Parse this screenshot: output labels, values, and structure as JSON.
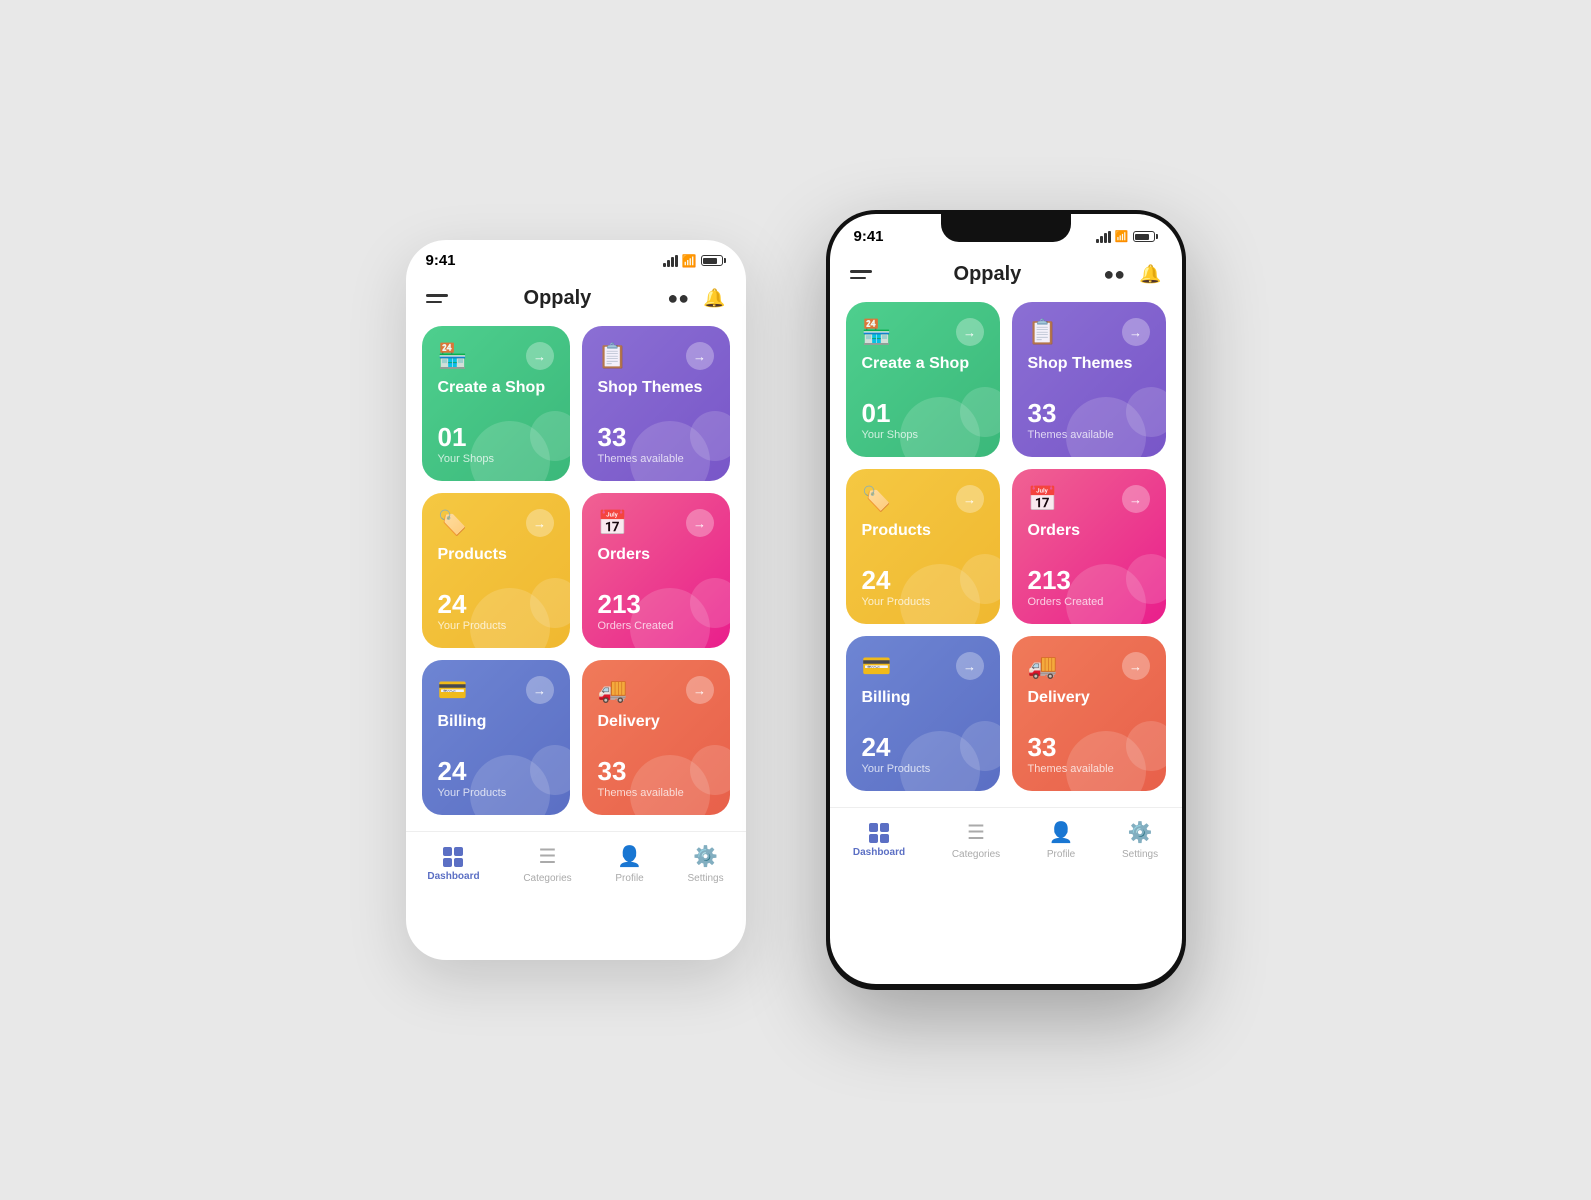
{
  "app": {
    "title": "Oppaly",
    "time": "9:41"
  },
  "header": {
    "menu_label": "menu",
    "search_label": "search",
    "bell_label": "notifications"
  },
  "cards": [
    {
      "id": "create-shop",
      "color": "card-green",
      "icon": "🏪",
      "title": "Create a Shop",
      "number": "01",
      "subtitle": "Your Shops"
    },
    {
      "id": "shop-themes",
      "color": "card-purple",
      "icon": "📋",
      "title": "Shop Themes",
      "number": "33",
      "subtitle": "Themes available"
    },
    {
      "id": "products",
      "color": "card-yellow",
      "icon": "🏷️",
      "title": "Products",
      "number": "24",
      "subtitle": "Your Products"
    },
    {
      "id": "orders",
      "color": "card-pink",
      "icon": "📅",
      "title": "Orders",
      "number": "213",
      "subtitle": "Orders Created"
    },
    {
      "id": "billing",
      "color": "card-blue",
      "icon": "💳",
      "title": "Billing",
      "number": "24",
      "subtitle": "Your Products"
    },
    {
      "id": "delivery",
      "color": "card-orange",
      "icon": "🚚",
      "title": "Delivery",
      "number": "33",
      "subtitle": "Themes available"
    }
  ],
  "nav": {
    "items": [
      {
        "id": "dashboard",
        "label": "Dashboard",
        "active": true
      },
      {
        "id": "categories",
        "label": "Categories",
        "active": false
      },
      {
        "id": "profile",
        "label": "Profile",
        "active": false
      },
      {
        "id": "settings",
        "label": "Settings",
        "active": false
      }
    ]
  }
}
